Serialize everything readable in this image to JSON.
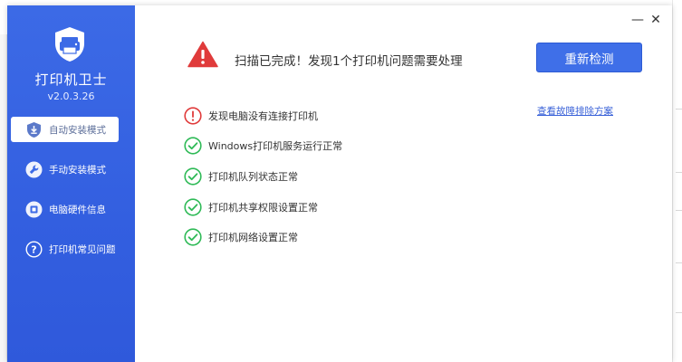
{
  "app": {
    "name": "打印机卫士",
    "version": "v2.0.3.26"
  },
  "sidebar": {
    "items": [
      {
        "label": "自动安装模式",
        "icon": "download-shield-icon",
        "active": true
      },
      {
        "label": "手动安装模式",
        "icon": "wrench-icon",
        "active": false
      },
      {
        "label": "电脑硬件信息",
        "icon": "hardware-chip-icon",
        "active": false
      },
      {
        "label": "打印机常见问题",
        "icon": "question-icon",
        "active": false
      }
    ]
  },
  "window_controls": {
    "minimize": "—",
    "close": "✕"
  },
  "header": {
    "status_text": "扫描已完成！发现1个打印机问题需要处理",
    "status_icon": "warning-triangle-icon",
    "recheck_label": "重新检测"
  },
  "results": {
    "items": [
      {
        "text": "发现电脑没有连接打印机",
        "status": "error"
      },
      {
        "text": "Windows打印机服务运行正常",
        "status": "ok"
      },
      {
        "text": "打印机队列状态正常",
        "status": "ok"
      },
      {
        "text": "打印机共享权限设置正常",
        "status": "ok"
      },
      {
        "text": "打印机网络设置正常",
        "status": "ok"
      }
    ],
    "solution_link": "查看故障排除方案"
  },
  "colors": {
    "sidebar": "#335fe0",
    "accent": "#3f6fe8",
    "error": "#e03b3b",
    "ok": "#2fba57",
    "link": "#3a62d8"
  }
}
